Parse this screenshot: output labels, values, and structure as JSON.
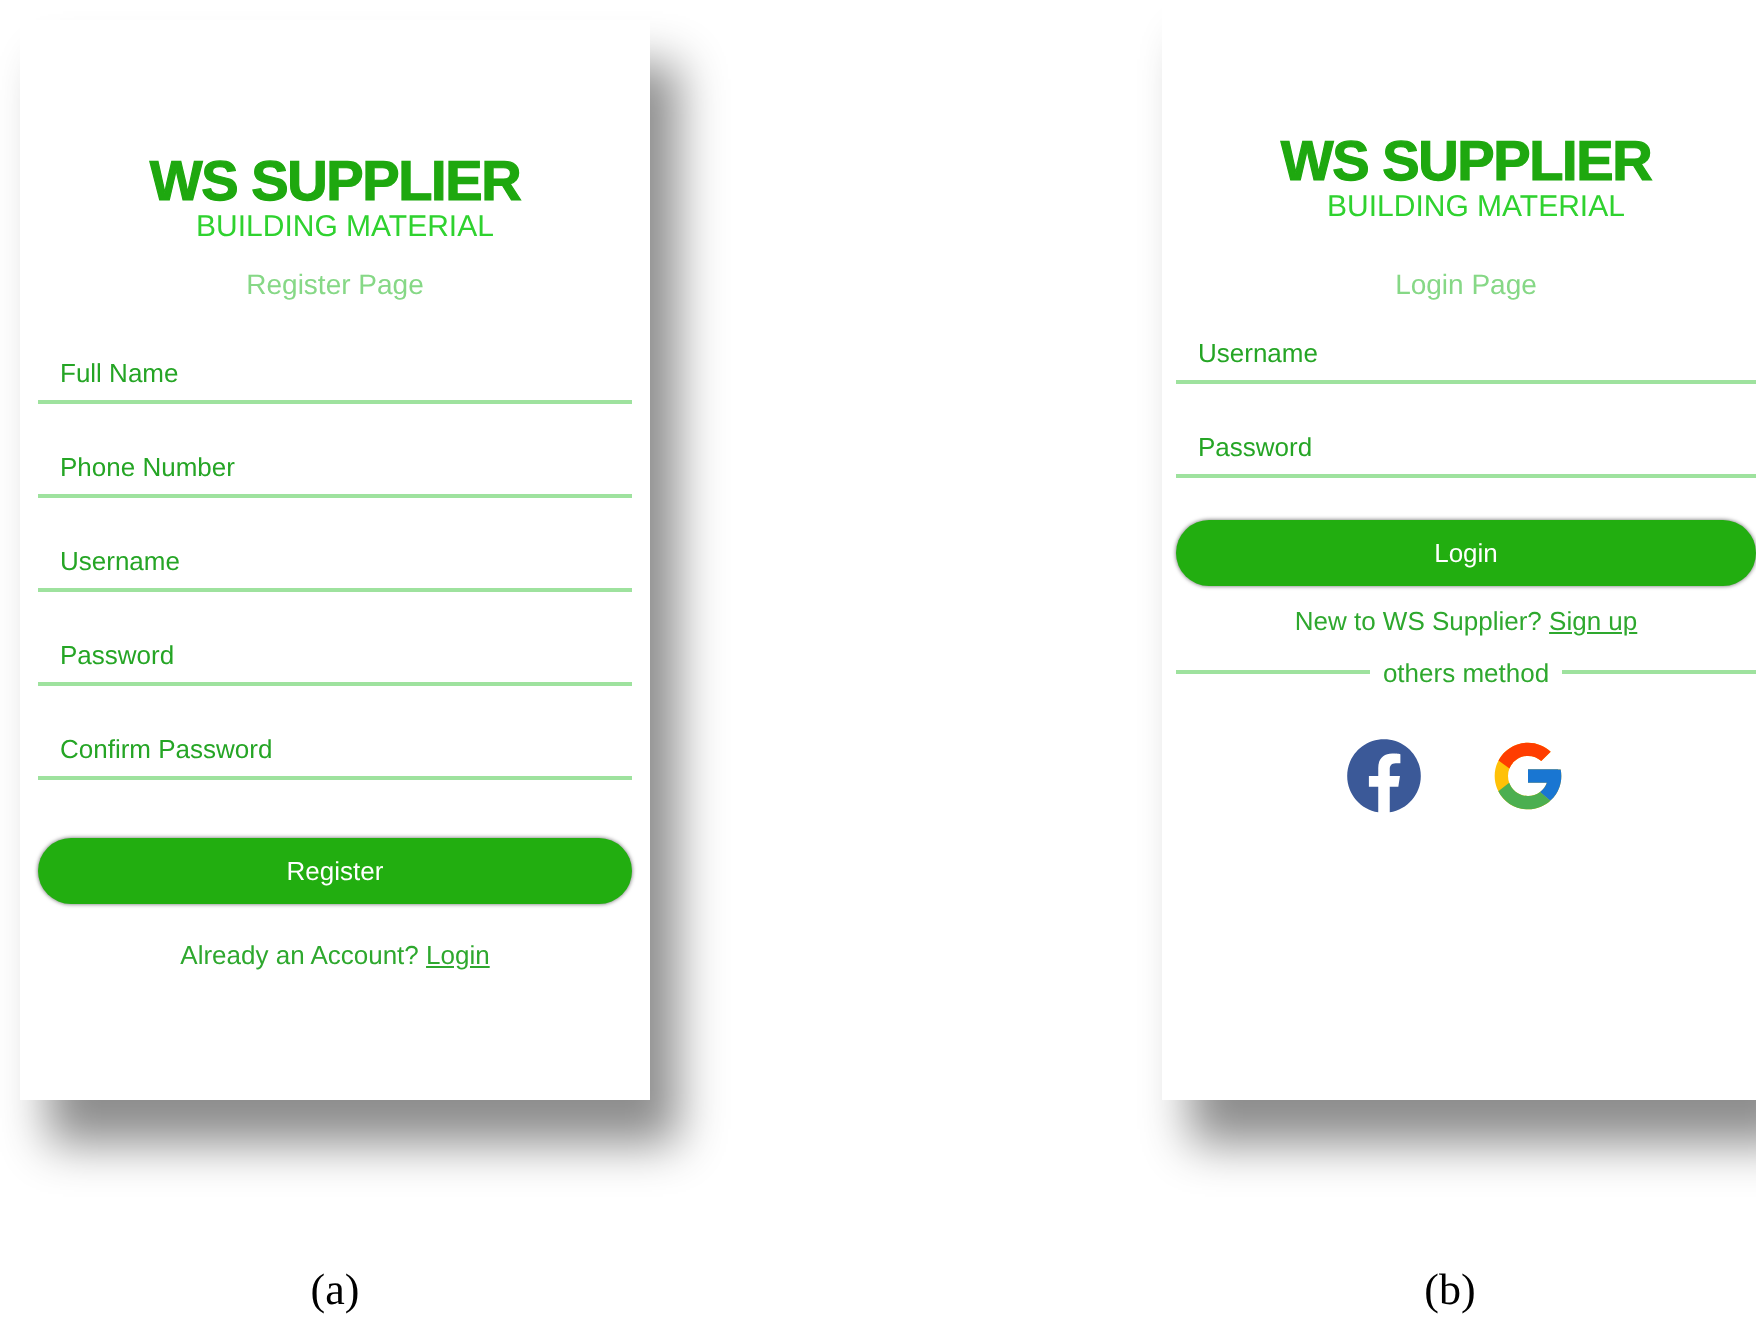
{
  "figures": [
    {
      "caption": "(a)",
      "brand": {
        "title": "WS SUPPLIER",
        "subtitle": "BUILDING MATERIAL"
      },
      "page_title": "Register Page",
      "fields": [
        {
          "placeholder": "Full Name"
        },
        {
          "placeholder": "Phone Number"
        },
        {
          "placeholder": "Username"
        },
        {
          "placeholder": "Password"
        },
        {
          "placeholder": "Confirm Password"
        }
      ],
      "submit_button": "Register",
      "footer": {
        "text": "Already an Account?",
        "link": "Login"
      }
    },
    {
      "caption": "(b)",
      "brand": {
        "title": "WS SUPPLIER",
        "subtitle": "BUILDING MATERIAL"
      },
      "page_title": "Login Page",
      "fields": [
        {
          "placeholder": "Username"
        },
        {
          "placeholder": "Password"
        }
      ],
      "submit_button": "Login",
      "footer": {
        "text": "New to WS Supplier?",
        "link": "Sign up"
      },
      "divider_text": "others method",
      "social": [
        {
          "kind": "facebook"
        },
        {
          "kind": "google"
        }
      ]
    }
  ]
}
